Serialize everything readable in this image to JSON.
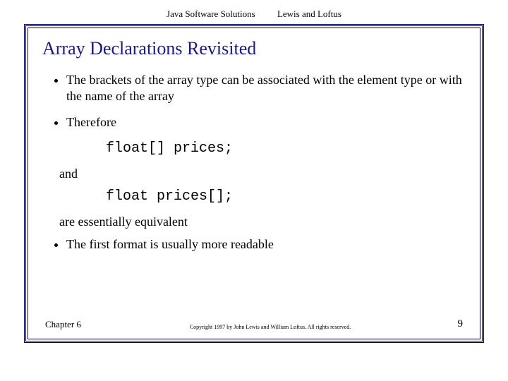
{
  "header": {
    "book": "Java Software Solutions",
    "authors": "Lewis and Loftus"
  },
  "slide": {
    "title": "Array Declarations Revisited",
    "bullets": {
      "b1": "The brackets of the array type can be associated with the element type or with the name of the array",
      "b2": "Therefore",
      "b3": "The first format is usually more readable"
    },
    "code1": "float[] prices;",
    "between1": "and",
    "code2": "float prices[];",
    "between2": "are essentially equivalent"
  },
  "footer": {
    "chapter": "Chapter 6",
    "copyright": "Copyright 1997 by John Lewis and William Loftus. All rights reserved.",
    "page": "9"
  }
}
